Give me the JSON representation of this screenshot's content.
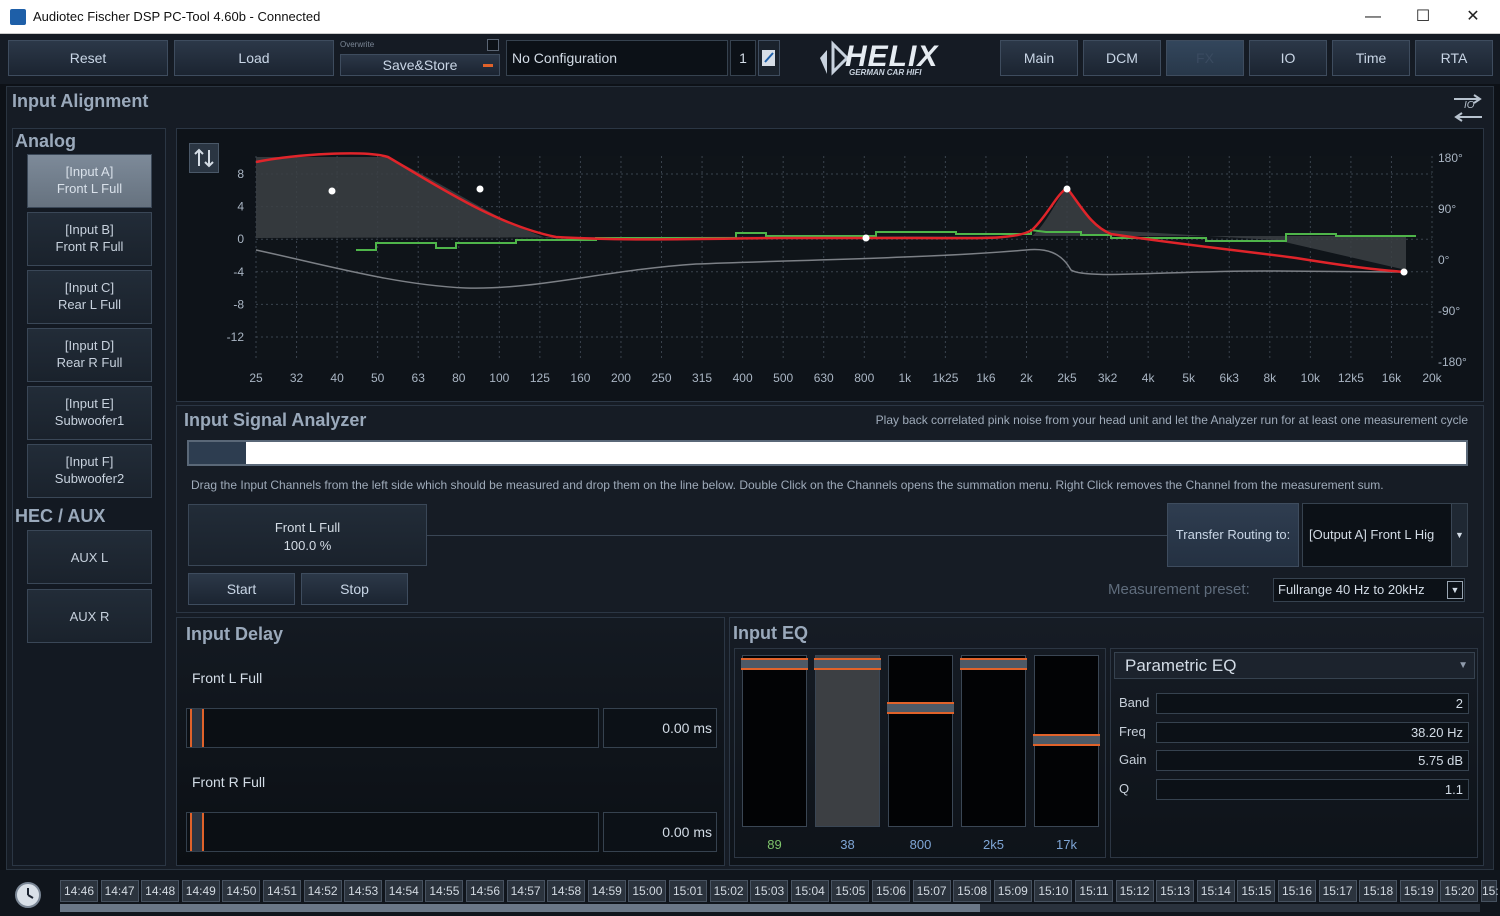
{
  "window": {
    "title": "Audiotec Fischer DSP PC-Tool 4.60b - Connected",
    "minimize": "—",
    "maximize": "☐",
    "close": "✕"
  },
  "toolbar": {
    "reset": "Reset",
    "load": "Load",
    "overwrite_label": "Overwrite",
    "save_store": "Save&Store",
    "config_name": "No Configuration",
    "config_number": "1",
    "logo_main": "HELIX",
    "logo_sub": "GERMAN CAR HIFI",
    "tabs": [
      "Main",
      "DCM",
      "FX",
      "IO",
      "Time",
      "RTA"
    ]
  },
  "page": {
    "title": "Input Alignment",
    "io_icon_label": "IO"
  },
  "sidebar": {
    "analog_title": "Analog",
    "hec_title": "HEC / AUX",
    "inputs": [
      {
        "line1": "[Input A]",
        "line2": "Front L Full"
      },
      {
        "line1": "[Input B]",
        "line2": "Front R Full"
      },
      {
        "line1": "[Input C]",
        "line2": "Rear L Full"
      },
      {
        "line1": "[Input D]",
        "line2": "Rear R Full"
      },
      {
        "line1": "[Input E]",
        "line2": "Subwoofer1"
      },
      {
        "line1": "[Input F]",
        "line2": "Subwoofer2"
      }
    ],
    "aux": [
      "AUX L",
      "AUX R"
    ]
  },
  "graph": {
    "y_ticks": [
      "8",
      "4",
      "0",
      "-4",
      "-8",
      "-12"
    ],
    "phase_ticks": [
      "180°",
      "90°",
      "0°",
      "-90°",
      "-180°"
    ],
    "x_ticks": [
      "25",
      "32",
      "40",
      "50",
      "63",
      "80",
      "100",
      "125",
      "160",
      "200",
      "250",
      "315",
      "400",
      "500",
      "630",
      "800",
      "1k",
      "1k25",
      "1k6",
      "2k",
      "2k5",
      "3k2",
      "4k",
      "5k",
      "6k3",
      "8k",
      "10k",
      "12k5",
      "16k",
      "20k"
    ]
  },
  "analyzer": {
    "title": "Input Signal Analyzer",
    "hint": "Play back correlated pink noise from your head unit and let the Analyzer run for at least one measurement cycle",
    "progress": 0.045,
    "instructions": "Drag the Input Channels from the left side which should be measured and drop them on the line below. Double Click on the Channels opens the summation menu. Right Click removes the Channel from the measurement sum.",
    "channel_name": "Front L Full",
    "channel_percent": "100.0 %",
    "start": "Start",
    "stop": "Stop",
    "transfer_label": "Transfer Routing to:",
    "transfer_target": "[Output A] Front L Hig",
    "preset_label": "Measurement preset:",
    "preset_value": "Fullrange 40 Hz to 20kHz"
  },
  "delay": {
    "title": "Input Delay",
    "channels": [
      {
        "name": "Front L Full",
        "value": "0.00 ms"
      },
      {
        "name": "Front R Full",
        "value": "0.00 ms"
      }
    ]
  },
  "eq": {
    "title": "Input EQ",
    "bands": [
      "89",
      "38",
      "800",
      "2k5",
      "17k"
    ],
    "mode": "Parametric EQ",
    "band_label": "Band",
    "band_value": "2",
    "freq_label": "Freq",
    "freq_value": "38.20 Hz",
    "gain_label": "Gain",
    "gain_value": "5.75 dB",
    "q_label": "Q",
    "q_value": "1.1"
  },
  "timeline": [
    "14:46",
    "14:47",
    "14:48",
    "14:49",
    "14:50",
    "14:51",
    "14:52",
    "14:53",
    "14:54",
    "14:55",
    "14:56",
    "14:57",
    "14:58",
    "14:59",
    "15:00",
    "15:01",
    "15:02",
    "15:03",
    "15:04",
    "15:05",
    "15:06",
    "15:07",
    "15:08",
    "15:09",
    "15:10",
    "15:11",
    "15:12",
    "15:13",
    "15:14",
    "15:15",
    "15:16",
    "15:17",
    "15:18",
    "15:19",
    "15:20",
    "15:"
  ],
  "colors": {
    "accent_orange": "#e0622a",
    "curve_red": "#e0242a",
    "curve_green": "#4fb54a",
    "band_label_green": "#7dc36a",
    "band_label_blue": "#7fa6d6"
  }
}
